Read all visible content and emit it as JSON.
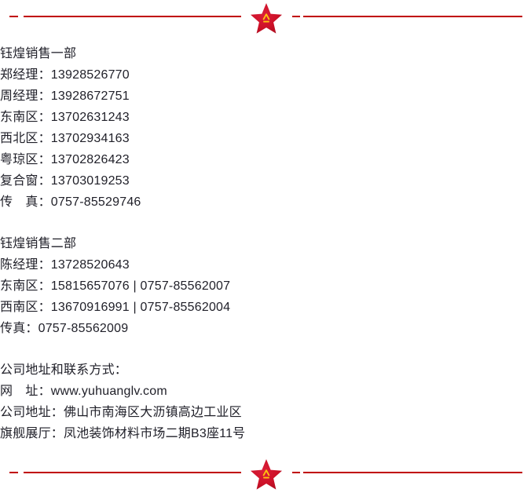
{
  "divider": {
    "icon": "red-star-bayi-emblem",
    "emblem_text": "八一",
    "rule_color": "#C00000",
    "star_color": "#C8102E",
    "emblem_color": "#FFC20E"
  },
  "contact": {
    "blocks": [
      {
        "id": "sales-dept-1",
        "lines": [
          "钰煌销售一部",
          "郑经理：13928526770",
          "周经理：13928672751",
          "东南区：13702631243",
          "西北区：13702934163",
          "粤琼区：13702826423",
          "复合窗：13703019253",
          "传　真：0757-85529746"
        ]
      },
      {
        "id": "sales-dept-2",
        "lines": [
          "钰煌销售二部",
          "陈经理：13728520643",
          "东南区：15815657076 | 0757-85562007",
          "西南区：13670916991 | 0757-85562004",
          "传真：0757-85562009"
        ]
      },
      {
        "id": "company-address",
        "lines": [
          "公司地址和联系方式：",
          "网　址：www.yuhuanglv.com",
          "公司地址：佛山市南海区大沥镇高边工业区",
          "旗舰展厅：凤池装饰材料市场二期B3座11号"
        ]
      }
    ]
  }
}
